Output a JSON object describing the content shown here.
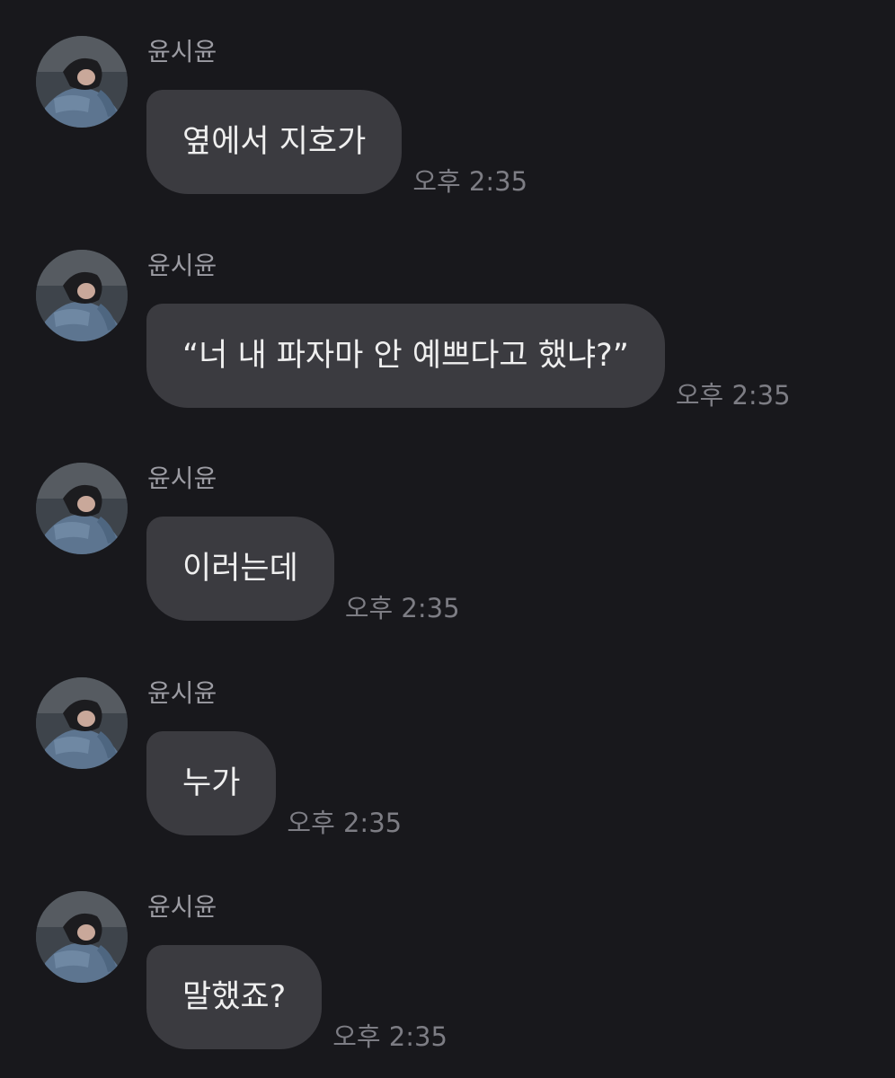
{
  "messages": [
    {
      "sender": "윤시윤",
      "text": "옆에서 지호가",
      "time": "오후 2:35"
    },
    {
      "sender": "윤시윤",
      "text": "“너 내 파자마 안 예쁘다고 했냐?”",
      "time": "오후 2:35"
    },
    {
      "sender": "윤시윤",
      "text": "이러는데",
      "time": "오후 2:35"
    },
    {
      "sender": "윤시윤",
      "text": "누가",
      "time": "오후 2:35"
    },
    {
      "sender": "윤시윤",
      "text": "말했죠?",
      "time": "오후 2:35"
    }
  ],
  "colors": {
    "background": "#18181c",
    "bubble": "#3b3b40",
    "bubble_text": "#efefef",
    "sender_name": "#9c9ca3",
    "timestamp": "#7d7d84"
  },
  "icons": {
    "avatar": "profile-photo"
  }
}
